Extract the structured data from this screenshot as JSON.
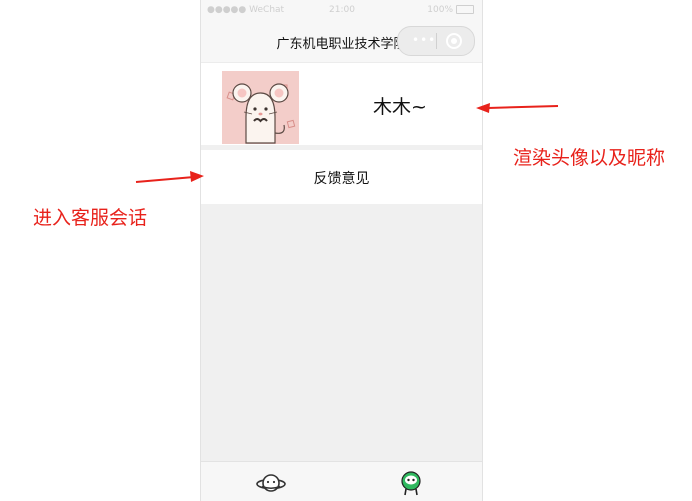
{
  "status_bar": {
    "signal": "●●●●● WeChat",
    "time": "21:00",
    "battery": "100%"
  },
  "nav": {
    "title": "广东机电职业技术学院",
    "menu_dots": "•••"
  },
  "profile": {
    "nickname": "木木~"
  },
  "menu": {
    "feedback_label": "反馈意见"
  },
  "tabs": [
    {
      "icon": "planet-icon"
    },
    {
      "icon": "user-profile-icon",
      "active": true
    }
  ],
  "annotations": {
    "render_note": "渲染头像以及昵称",
    "service_note": "进入客服会话"
  },
  "colors": {
    "annotation": "#e8221b",
    "accent_green": "#2fb85f"
  }
}
